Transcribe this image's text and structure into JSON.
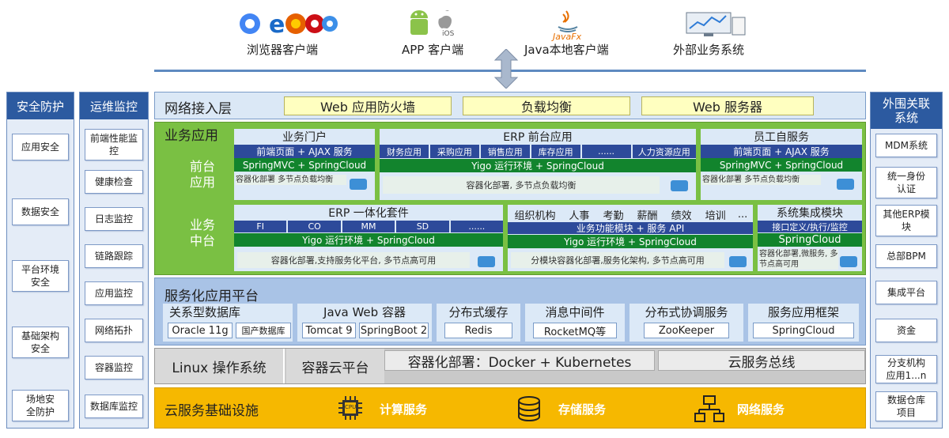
{
  "clients": [
    {
      "label": "浏览器客户端",
      "icon": "browser-icons"
    },
    {
      "label": "APP 客户端",
      "icon": "android-apple-icon"
    },
    {
      "label": "Java本地客户端",
      "icon": "java-icon",
      "sub": "JavaFx"
    },
    {
      "label": "外部业务系统",
      "icon": "monitor-icon"
    }
  ],
  "ios_label": "iOS",
  "left_security": {
    "title": "安全防护",
    "items": [
      "应用安全",
      "数据安全",
      "平台环境安全",
      "基础架构安全",
      "场地安全防护"
    ]
  },
  "left_ops": {
    "title": "运维监控",
    "items": [
      "前端性能监控",
      "健康检查",
      "日志监控",
      "链路跟踪",
      "应用监控",
      "网络拓扑",
      "容器监控",
      "数据库监控"
    ]
  },
  "right_ext": {
    "title": "外围关联系统",
    "items": [
      "MDM系统",
      "统一身份认证",
      "其他ERP模块",
      "总部BPM",
      "集成平台",
      "资金",
      "分支机构应用1...n",
      "数据仓库项目"
    ]
  },
  "network_layer": {
    "title": "网络接入层",
    "items": [
      "Web 应用防火墙",
      "负载均衡",
      "Web 服务器"
    ]
  },
  "business": {
    "title": "业务应用",
    "front_label": "前台应用",
    "mid_label": "业务中台",
    "portal": {
      "title": "业务门户",
      "nav": "前端页面 + AJAX 服务",
      "env": "SpringMVC + SpringCloud",
      "note": "容器化部署 多节点负载均衡"
    },
    "erp_front": {
      "title": "ERP 前台应用",
      "cells": [
        "财务应用",
        "采购应用",
        "销售应用",
        "库存应用",
        "......",
        "人力资源应用"
      ],
      "env": "Yigo 运行环境 + SpringCloud",
      "note": "容器化部署, 多节点负载均衡"
    },
    "self_service": {
      "title": "员工自服务",
      "nav": "前端页面 + AJAX 服务",
      "env": "SpringMVC + SpringCloud",
      "note": "容器化部署 多节点负载均衡"
    },
    "erp_suite": {
      "title": "ERP 一体化套件",
      "cells": [
        "FI",
        "CO",
        "MM",
        "SD",
        "......"
      ],
      "env": "Yigo 运行环境 + SpringCloud",
      "note": "容器化部署,支持服务化平台, 多节点高可用"
    },
    "org": {
      "cells": [
        "组织机构",
        "人事",
        "考勤",
        "薪酬",
        "绩效",
        "培训",
        "..."
      ],
      "api": "业务功能模块 + 服务 API",
      "env": "Yigo 运行环境 + SpringCloud",
      "note": "分模块容器化部署,服务化架构, 多节点高可用"
    },
    "integration": {
      "title": "系统集成模块",
      "nav": "接口定义/执行/监控",
      "env": "SpringCloud",
      "note": "容器化部署,微服务, 多节点高可用"
    }
  },
  "service_platform": {
    "title": "服务化应用平台",
    "groups": [
      {
        "title": "关系型数据库",
        "items": [
          "Oracle 11g",
          "国产数据库"
        ]
      },
      {
        "title": "Java Web 容器",
        "items": [
          "Tomcat 9",
          "SpringBoot 2"
        ]
      },
      {
        "title": "分布式缓存",
        "items": [
          "Redis"
        ]
      },
      {
        "title": "消息中间件",
        "items": [
          "RocketMQ等"
        ]
      },
      {
        "title": "分布式协调服务",
        "items": [
          "ZooKeeper"
        ]
      },
      {
        "title": "服务应用框架",
        "items": [
          "SpringCloud"
        ]
      }
    ]
  },
  "os_layer": {
    "linux": "Linux 操作系统",
    "cloud": "容器云平台",
    "docker": "容器化部署：Docker + Kubernetes",
    "bus": "云服务总线"
  },
  "infra": {
    "title": "云服务基础设施",
    "cpu_label": "CPU",
    "items": [
      {
        "label": "计算服务",
        "icon": "cpu-icon"
      },
      {
        "label": "存储服务",
        "icon": "database-icon"
      },
      {
        "label": "网络服务",
        "icon": "network-icon"
      }
    ]
  },
  "docker_label": "docker",
  "colors": {
    "blue_dark": "#2c5aa0",
    "green": "#76bc3f",
    "green_dark": "#12842d",
    "yellow": "#f4b800",
    "gray": "#b7b7b7"
  }
}
